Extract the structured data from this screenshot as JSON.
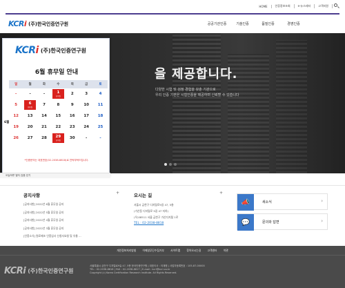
{
  "top_links": [
    "HOME",
    "인증정보조회",
    "e-뉴스레터",
    "고객지원"
  ],
  "org": {
    "logo_mark": "KCR",
    "logo_mark_i": "i",
    "name": "(주)한국인증연구원"
  },
  "gnb": [
    "공공기관인증",
    "기술인증",
    "품질인증",
    "경영인증"
  ],
  "hero": {
    "title": "을 제공합니다.",
    "sub_lines": [
      "다양한 시험 및 검정 경험을 갖춘 기관으로",
      "우리 인증 기관은 시험인증을 제공하며 신뢰할 수 있습니다"
    ],
    "dots": [
      true,
      false,
      false
    ]
  },
  "popup": {
    "title": "6월 휴무일 안내",
    "month_label": "6월",
    "weekdays": [
      "일",
      "월",
      "화",
      "수",
      "목",
      "금",
      "토"
    ],
    "days": [
      [
        "-",
        "-",
        "-",
        "1",
        "2",
        "3",
        "4"
      ],
      [
        "5",
        "6",
        "7",
        "8",
        "9",
        "10",
        "11"
      ],
      [
        "12",
        "13",
        "14",
        "15",
        "16",
        "17",
        "18"
      ],
      [
        "19",
        "20",
        "21",
        "22",
        "23",
        "24",
        "25"
      ],
      [
        "26",
        "27",
        "28",
        "29",
        "30",
        "-",
        "-"
      ]
    ],
    "holidays": [
      {
        "row": 0,
        "col": 3,
        "tag": "휴무일"
      },
      {
        "row": 1,
        "col": 1,
        "tag": "현충일"
      },
      {
        "row": 4,
        "col": 3,
        "tag": "휴무일"
      }
    ],
    "note": "*인증문의는 대표번호(02-2038-8818)로 연락부탁드립니다.",
    "bar_label": "오늘하루 열지 않음 닫기"
  },
  "notice": {
    "title": "공지사항",
    "items": [
      "[공지사항] 2022년 6월 휴무일 공지",
      "[공지사항] 2022년 5월 휴무일 공지",
      "[공지사항] 2022년 4월 휴무일 공지",
      "[공지사항] 2022년 3월 휴무일 공지",
      "[인증소식] 원료제조 인증심사 신청서요청 및 유통 ..."
    ],
    "more": "+"
  },
  "directions": {
    "title": "오시는 길",
    "lines": [
      "서울시 금천구 디지털로9길 47, 5층",
      "(가산동 디지털로 9길 47 지하)",
      "(우)08511 서울 금천구 가산디지털 1로"
    ],
    "tel": "TEL : 02-2038-8818",
    "more": "+"
  },
  "side": [
    {
      "label": "새소식",
      "icon": "megaphone-icon",
      "glyph": "📣"
    },
    {
      "label": "문의와 답변",
      "icon": "chat-icon",
      "glyph": "💬"
    }
  ],
  "footer": {
    "links": [
      "개인정보처리방침",
      "이메일무단수집거부",
      "사이트맵",
      "찾아오시는길",
      "고객센터",
      "약관"
    ],
    "info": [
      "서울특별시 금천구 디지털로9길 47, 5층 한국인증연구원 | 대표이사 : 이재원 | 사업자등록번호 : 105-87-00000",
      "TEL : 02-2038-8818 | FAX : 02-2038-8817 | E-mail : kcri@kcri.co.kr",
      "Copyright (c) Korea Certification Research Institute. All Rights Reserved."
    ]
  },
  "colors": {
    "accent": "#4b3c8e",
    "brand_blue": "#1a73c8",
    "holiday_red": "#d9211d",
    "footer_bg": "#4a4a4a"
  }
}
